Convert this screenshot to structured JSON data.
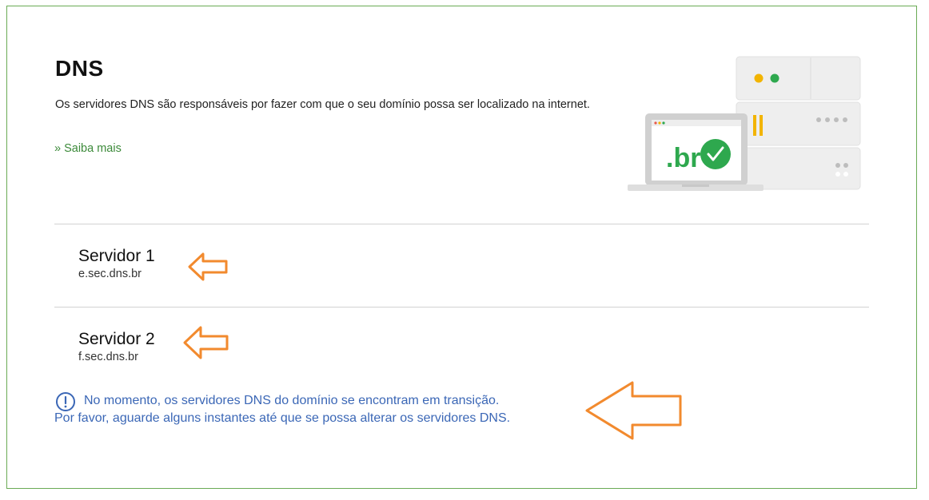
{
  "dns_section": {
    "title": "DNS",
    "description": "Os servidores DNS são responsáveis por fazer com que o seu domínio possa ser localizado na internet.",
    "learn_more": "» Saiba mais",
    "illustration_text": ".br"
  },
  "servers": [
    {
      "label": "Servidor 1",
      "host": "e.sec.dns.br"
    },
    {
      "label": "Servidor 2",
      "host": "f.sec.dns.br"
    }
  ],
  "notice": {
    "icon": "alert-circle-icon",
    "line1": "No momento, os servidores DNS do domínio se encontram em transição.",
    "line2": "Por favor, aguarde alguns instantes até que se possa alterar os servidores DNS."
  },
  "colors": {
    "border": "#6aab55",
    "link": "#3c8a3a",
    "notice": "#3b67b6",
    "annotation_arrow": "#f28a2e"
  }
}
